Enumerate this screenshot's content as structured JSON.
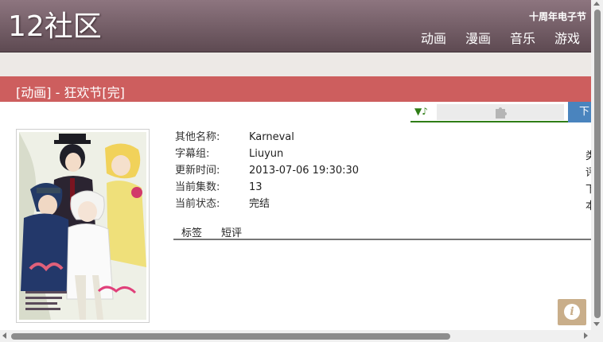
{
  "header": {
    "logo": "12社区",
    "anniversary": "十周年电子节",
    "nav": [
      "动画",
      "漫画",
      "音乐",
      "游戏"
    ]
  },
  "title": "[动画] - 狂欢节[完]",
  "player": {
    "music_icon": "▼♪",
    "plugin_icon": "puzzle-icon"
  },
  "download_label": "下",
  "info": [
    {
      "key": "其他名称:",
      "value": "Karneval",
      "right": "类"
    },
    {
      "key": "字幕组:",
      "value": "Liuyun",
      "right": ""
    },
    {
      "key": "更新时间:",
      "value": "2013-07-06 19:30:30",
      "right": "评"
    },
    {
      "key": "当前集数:",
      "value": "13",
      "right": "下"
    },
    {
      "key": "当前状态:",
      "value": "完结",
      "right": "本"
    }
  ],
  "tabs": [
    "标签",
    "短评"
  ],
  "info_button": "i",
  "colors": {
    "header": "#6f5a63",
    "title_bar": "#cd5e5e",
    "player_line": "#2f7d16",
    "download": "#4a84be",
    "info_button": "#c9ae8a"
  }
}
